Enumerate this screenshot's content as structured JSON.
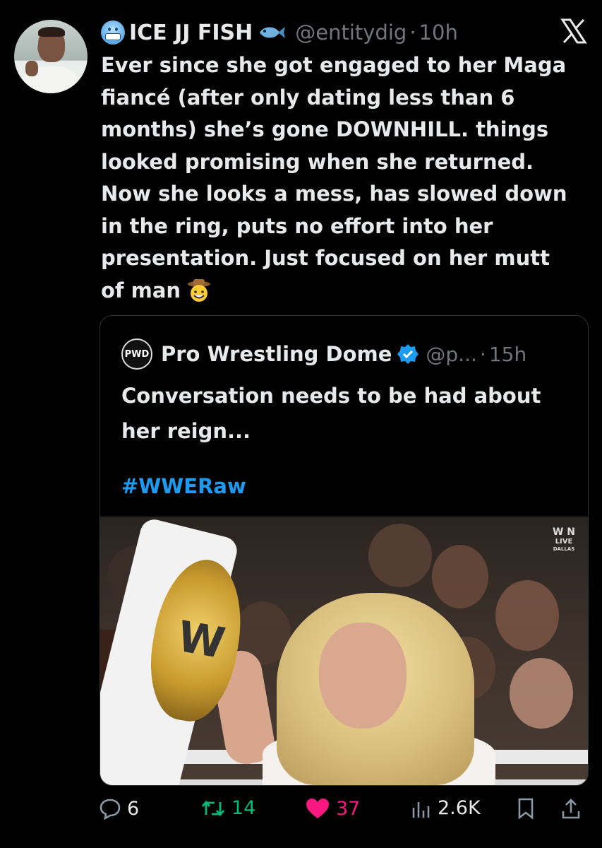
{
  "author": {
    "display_name": "ICE JJ FISH",
    "handle": "@entitydig",
    "separator": "·",
    "time": "10h"
  },
  "tweet": {
    "text": "Ever since she got engaged to her Maga\nfiancé (after only dating less than 6\nmonths) she’s gone DOWNHILL. things\nlooked promising when she returned.\nNow she looks a mess, has slowed down\nin the ring, puts no effort into her\npresentation. Just focused on her mutt\nof man"
  },
  "quote": {
    "display_name": "Pro Wrestling Dome",
    "handle": "@p...",
    "separator": "·",
    "time": "15h",
    "text": "Conversation needs to be had about her reign...",
    "hashtag": "#WWERaw",
    "logo_text": "PWD",
    "media_bug": [
      "W N",
      "LIVE",
      "DALLAS"
    ]
  },
  "actions": {
    "replies": "6",
    "reposts": "14",
    "likes": "37",
    "views": "2.6K"
  },
  "colors": {
    "background": "#000000",
    "text": "#e7e9ea",
    "muted": "#71767b",
    "link": "#1d9bf0",
    "repost": "#00ba7c",
    "like": "#f91880",
    "border": "#2f3336"
  },
  "icons": [
    "freezing-face-emoji",
    "fish-emoji",
    "x-logo",
    "cowboy-emoji",
    "verified-badge",
    "reply-icon",
    "repost-icon",
    "like-icon",
    "views-icon",
    "bookmark-icon",
    "share-icon"
  ]
}
